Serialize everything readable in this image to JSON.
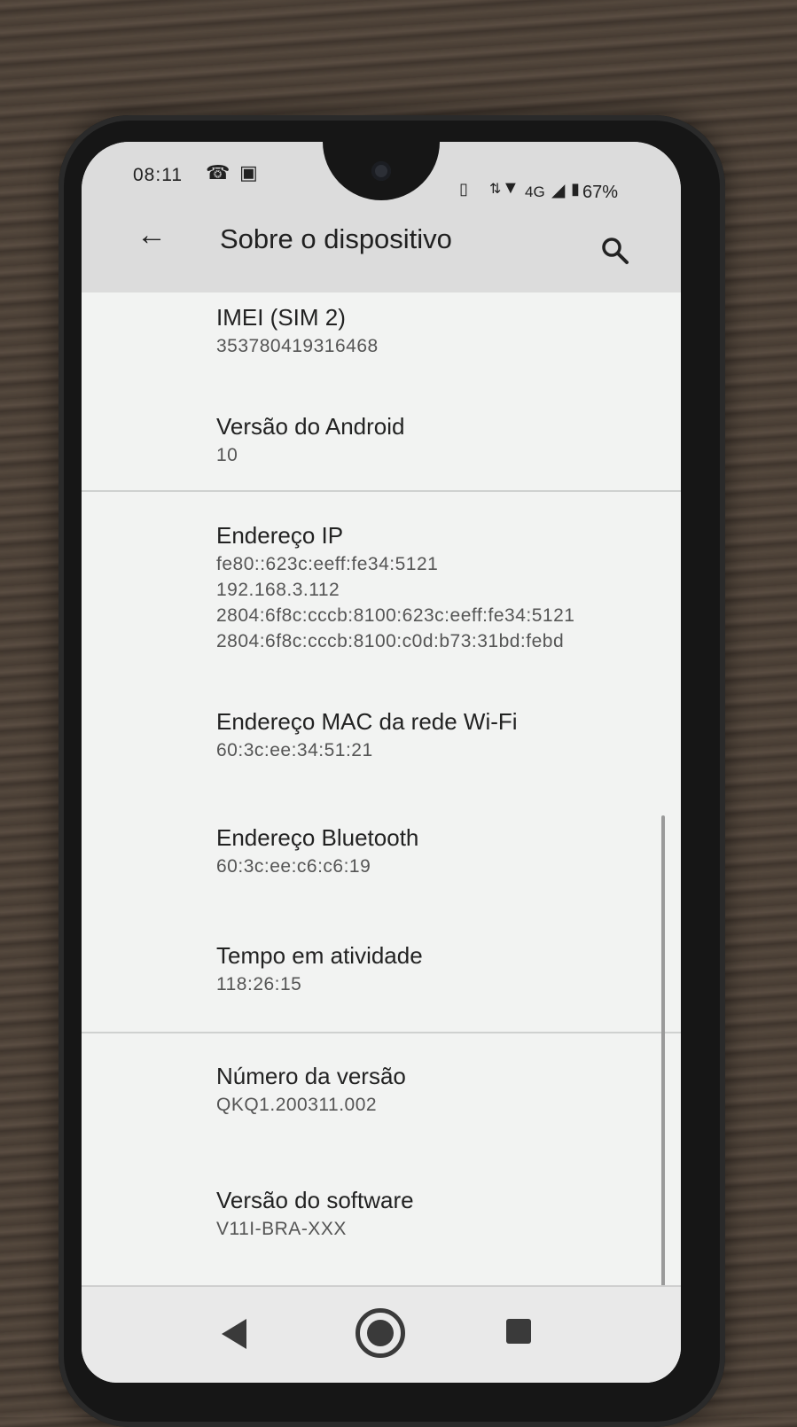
{
  "status_bar": {
    "time": "08:11",
    "network": "4G",
    "battery": "67%"
  },
  "app_bar": {
    "title": "Sobre o dispositivo"
  },
  "items": [
    {
      "title": "IMEI (SIM 2)",
      "value": "353780419316468"
    },
    {
      "title": "Versão do Android",
      "value": "10"
    },
    {
      "title": "Endereço IP",
      "values": [
        "fe80::623c:eeff:fe34:5121",
        "192.168.3.112",
        "2804:6f8c:cccb:8100:623c:eeff:fe34:5121",
        "2804:6f8c:cccb:8100:c0d:b73:31bd:febd"
      ]
    },
    {
      "title": "Endereço MAC da rede Wi-Fi",
      "value": "60:3c:ee:34:51:21"
    },
    {
      "title": "Endereço Bluetooth",
      "value": "60:3c:ee:c6:c6:19"
    },
    {
      "title": "Tempo em atividade",
      "value": "118:26:15"
    },
    {
      "title": "Número da versão",
      "value": "QKQ1.200311.002"
    },
    {
      "title": "Versão do software",
      "value": "V11I-BRA-XXX"
    }
  ],
  "colors": {
    "screen_bg": "#f2f3f2",
    "app_bar_bg": "#dcdcdc"
  }
}
